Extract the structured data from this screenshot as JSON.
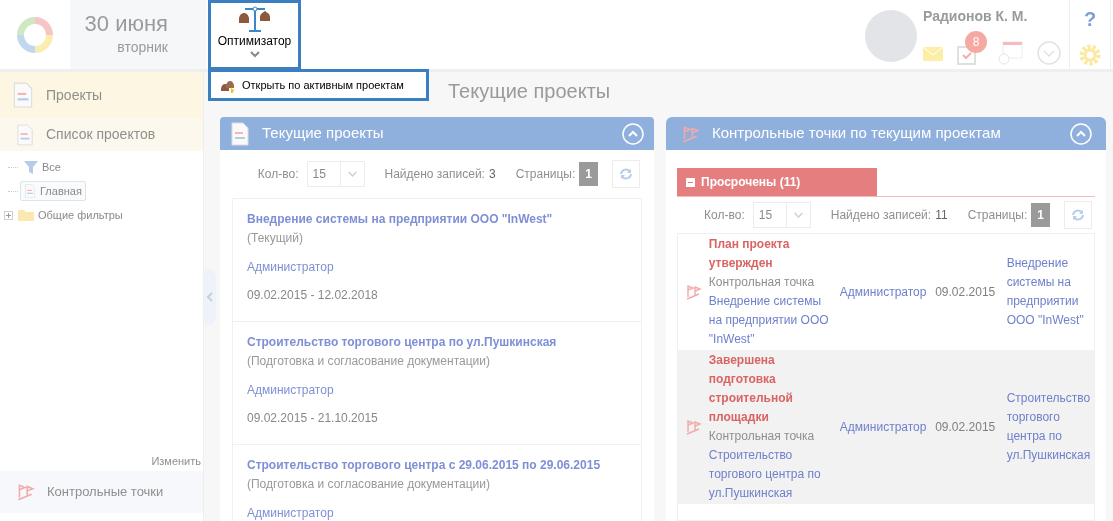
{
  "header": {
    "date": "30 июня",
    "weekday": "вторник",
    "optimizer": {
      "label": "Оптимизатор",
      "menu": [
        {
          "label": "Открыть по активным проектам"
        }
      ]
    },
    "user": {
      "name": "Радионов К. М.",
      "badge": "8"
    },
    "help": "?"
  },
  "sidebar": {
    "sections": [
      {
        "label": "Проекты",
        "selected": true
      }
    ],
    "list": {
      "label": "Список проектов"
    },
    "tree": [
      {
        "label": "Все",
        "kind": "filter",
        "selected": false
      },
      {
        "label": "Главная",
        "kind": "doc",
        "selected": true
      },
      {
        "label": "Общие фильтры",
        "kind": "folder",
        "selected": false,
        "expanded": false
      }
    ],
    "edit_link": "Изменить",
    "bottom": {
      "label": "Контрольные точки"
    }
  },
  "page_title": "Текущие проекты",
  "left_panel": {
    "title": "Текущие проекты",
    "pager": {
      "count_label": "Кол-во:",
      "count": "15",
      "found_label": "Найдено записей:",
      "found": "3",
      "pages_label": "Страницы:",
      "page": "1"
    },
    "projects": [
      {
        "title": "Внедрение системы на предприятии ООО \"InWest\"",
        "status": "(Текущий)",
        "owner": "Администратор",
        "dates": "09.02.2015 - 12.02.2018"
      },
      {
        "title": "Строительство торгового центра по ул.Пушкинская",
        "status": "(Подготовка и согласование документации)",
        "owner": "Администратор",
        "dates": "09.02.2015 - 21.10.2015"
      },
      {
        "title": "Строительство торгового центра с 29.06.2015 по 29.06.2015",
        "status": "(Подготовка и согласование документации)",
        "owner": "Администратор"
      }
    ]
  },
  "right_panel": {
    "title": "Контрольные точки по текущим проектам",
    "group": {
      "label": "Просрочены (11)",
      "expanded": true
    },
    "pager": {
      "count_label": "Кол-во:",
      "count": "15",
      "found_label": "Найдено записей:",
      "found": "11",
      "pages_label": "Страницы:",
      "page": "1"
    },
    "rows": [
      {
        "name": "План проекта утвержден",
        "type": "Контрольная точка",
        "project_link": "Внедрение системы на предприятии ООО \"InWest\"",
        "owner": "Администратор",
        "date": "09.02.2015",
        "project": "Внедрение системы на предприятии ООО \"InWest\"",
        "selected": false
      },
      {
        "name": "Завершена подготовка строительной площадки",
        "type": "Контрольная точка",
        "project_link": "Строительство торгового центра по ул.Пушкинская",
        "owner": "Администратор",
        "date": "09.02.2015",
        "project": "Строительство торгового центра по ул.Пушкинская",
        "selected": true
      }
    ]
  }
}
